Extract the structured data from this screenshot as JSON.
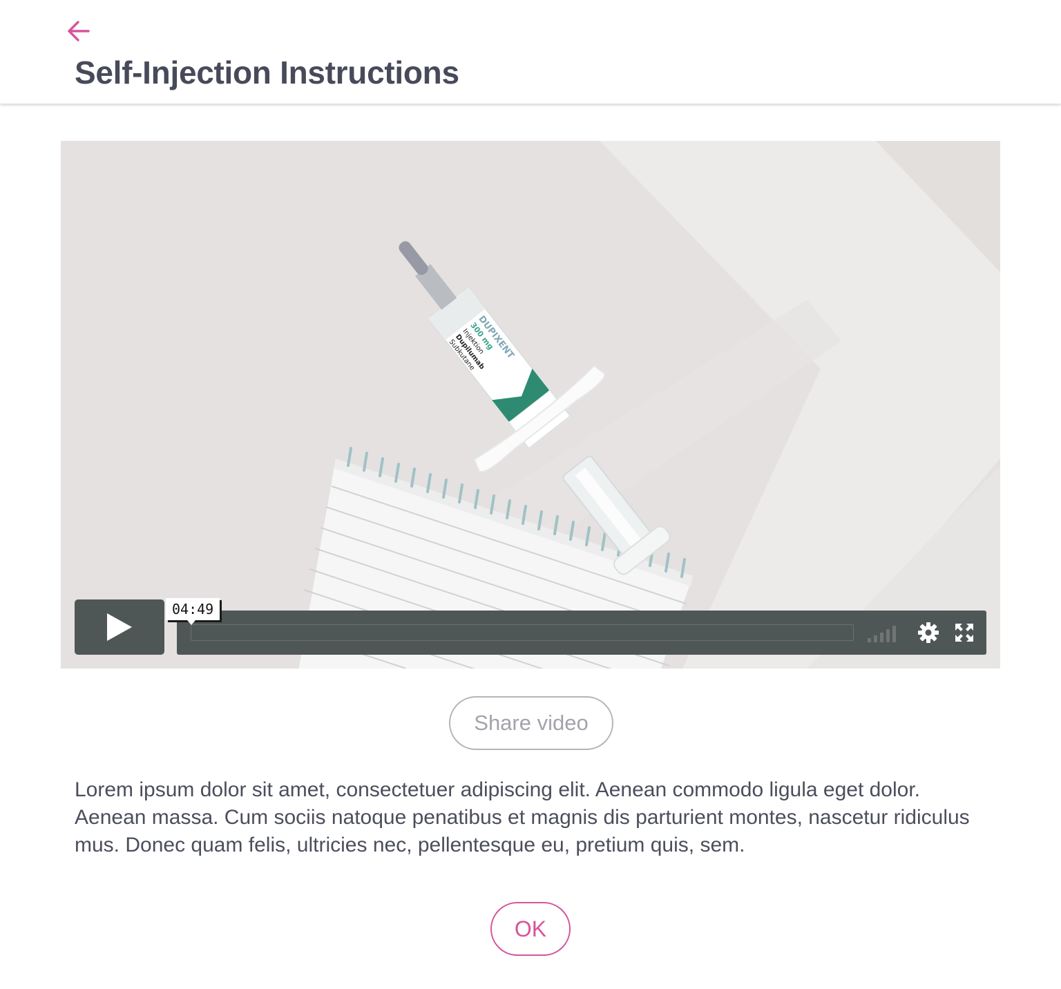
{
  "header": {
    "title": "Self-Injection Instructions",
    "back_icon": "arrow-left-icon"
  },
  "video": {
    "duration": "04:49",
    "progress": 0,
    "controls": {
      "play_icon": "play-icon",
      "volume_icon": "volume-bars-icon",
      "settings_icon": "gear-icon",
      "fullscreen_icon": "fullscreen-icon"
    },
    "syringe_label": [
      "DUPIXENT",
      "300 mg",
      "Injektion",
      "Dupilumab",
      "Subkutane"
    ]
  },
  "share_button": {
    "label": "Share video"
  },
  "description": "Lorem ipsum dolor sit amet, consectetuer adipiscing elit. Aenean commodo ligula eget dolor. Aenean massa. Cum sociis natoque penatibus et magnis dis parturient montes, nascetur ridiculus mus. Donec quam felis, ultricies nec, pellentesque eu, pretium quis, sem.",
  "ok_button": {
    "label": "OK"
  },
  "colors": {
    "accent": "#d6549b",
    "title": "#474a59",
    "control_bar": "#4f5656",
    "share_border": "#b5b5b9"
  }
}
